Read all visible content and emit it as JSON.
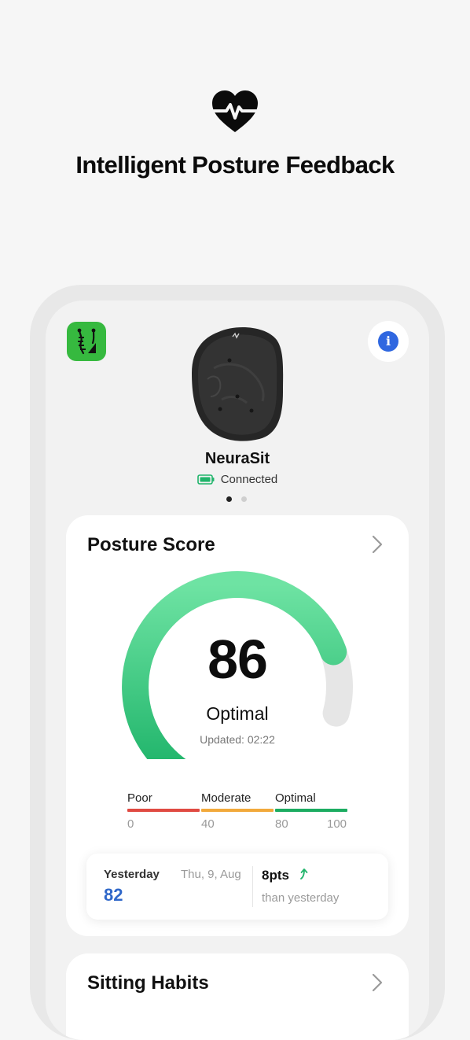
{
  "headline": "Intelligent Posture Feedback",
  "colors": {
    "accent_green": "#36b93f",
    "gauge_green_light": "#6ee3a3",
    "gauge_green_dark": "#1fb46a",
    "gauge_track": "#e6e6e6",
    "info_blue": "#2f67e0",
    "value_blue": "#2f67c9",
    "poor_red": "#e04a42",
    "moderate_orange": "#f2a93b",
    "optimal_green": "#1cac61"
  },
  "icons": {
    "hero": "heart-pulse-icon",
    "app_logo": "spine-posture-icon",
    "info": "info-icon",
    "battery": "battery-full-icon",
    "chevron": "chevron-right-icon",
    "trend": "trend-up-icon"
  },
  "device": {
    "name": "NeuraSit",
    "status": "Connected",
    "page_count": 2,
    "active_page": 1
  },
  "posture_score": {
    "title": "Posture Score",
    "score": "86",
    "score_fraction": 0.86,
    "label": "Optimal",
    "updated": "Updated: 02:22",
    "scale": {
      "segments": [
        {
          "label": "Poor",
          "from": 0,
          "to": 40
        },
        {
          "label": "Moderate",
          "from": 40,
          "to": 80
        },
        {
          "label": "Optimal",
          "from": 80,
          "to": 100
        }
      ],
      "ticks": [
        "0",
        "40",
        "80",
        "100"
      ]
    },
    "comparison": {
      "label": "Yesterday",
      "date": "Thu, 9, Aug",
      "value": "82",
      "delta": "8pts",
      "caption": "than yesterday"
    }
  },
  "sitting_habits": {
    "title": "Sitting Habits"
  }
}
